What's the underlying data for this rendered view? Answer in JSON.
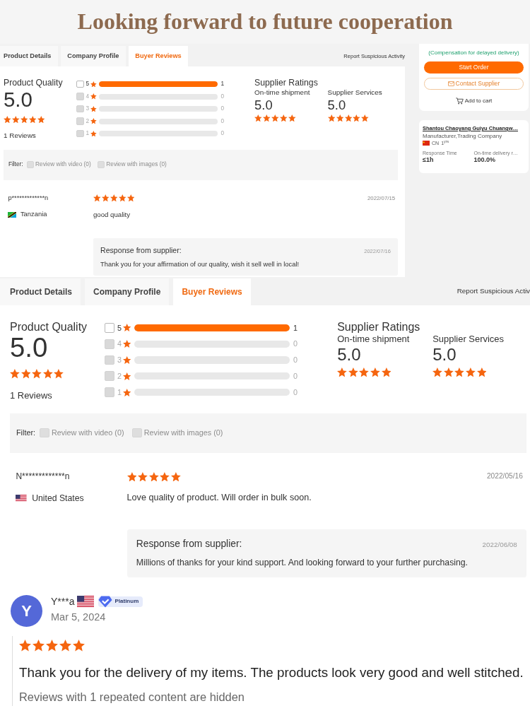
{
  "banner": {
    "title": "Looking forward to future cooperation"
  },
  "screens": [
    {
      "tabs": [
        {
          "label": "Product Details",
          "selected": false
        },
        {
          "label": "Company Profile",
          "selected": false
        },
        {
          "label": "Buyer Reviews",
          "selected": true
        }
      ],
      "report_link": "Report Suspicious Activity",
      "quality": {
        "label": "Product Quality",
        "score": "5.0",
        "stars": 5,
        "reviews": "1 Reviews"
      },
      "breakdown": [
        {
          "label": "5",
          "count": "1",
          "level": 1,
          "checked": false,
          "disabled": false
        },
        {
          "label": "4",
          "count": "0",
          "level": 0,
          "checked": false,
          "disabled": true
        },
        {
          "label": "3",
          "count": "0",
          "level": 0,
          "checked": false,
          "disabled": true
        },
        {
          "label": "2",
          "count": "0",
          "level": 0,
          "checked": false,
          "disabled": true
        },
        {
          "label": "1",
          "count": "0",
          "level": 0,
          "checked": false,
          "disabled": true
        }
      ],
      "supplier_ratings": {
        "title": "Supplier Ratings",
        "items": [
          {
            "label": "On-time shipment",
            "score": "5.0",
            "stars": 5
          },
          {
            "label": "Supplier Services",
            "score": "5.0",
            "stars": 5
          }
        ]
      },
      "filter": {
        "label": "Filter:",
        "options": [
          {
            "label": "Review with video (0)",
            "checked": false,
            "disabled": true
          },
          {
            "label": "Review with images (0)",
            "checked": false,
            "disabled": true
          }
        ]
      },
      "review": {
        "buyer": "p*************n",
        "country": "Tanzania",
        "stars": 5,
        "date": "2022/07/15",
        "text": "good quality",
        "response": {
          "title": "Response from supplier:",
          "date": "2022/07/16",
          "text": "Thank you for your affirmation of our quality, wish it sell well in local!"
        }
      }
    },
    {
      "tabs": [
        {
          "label": "Product Details",
          "selected": false
        },
        {
          "label": "Company Profile",
          "selected": false
        },
        {
          "label": "Buyer Reviews",
          "selected": true
        }
      ],
      "report_link": "Report Suspicious Activ",
      "quality": {
        "label": "Product Quality",
        "score": "5.0",
        "stars": 5,
        "reviews": "1 Reviews"
      },
      "breakdown": [
        {
          "label": "5",
          "count": "1",
          "level": 1,
          "checked": false,
          "disabled": false
        },
        {
          "label": "4",
          "count": "0",
          "level": 0,
          "checked": false,
          "disabled": true
        },
        {
          "label": "3",
          "count": "0",
          "level": 0,
          "checked": false,
          "disabled": true
        },
        {
          "label": "2",
          "count": "0",
          "level": 0,
          "checked": false,
          "disabled": true
        },
        {
          "label": "1",
          "count": "0",
          "level": 0,
          "checked": false,
          "disabled": true
        }
      ],
      "supplier_ratings": {
        "title": "Supplier Ratings",
        "items": [
          {
            "label": "On-time shipment",
            "score": "5.0",
            "stars": 5
          },
          {
            "label": "Supplier Services",
            "score": "5.0",
            "stars": 5
          }
        ]
      },
      "filter": {
        "label": "Filter:",
        "options": [
          {
            "label": "Review with video (0)",
            "checked": false,
            "disabled": true
          },
          {
            "label": "Review with images (0)",
            "checked": false,
            "disabled": true
          }
        ]
      },
      "review": {
        "buyer": "N*************n",
        "country": "United States",
        "stars": 5,
        "date": "2022/05/16",
        "text": "Love quality of product. Will order in bulk soon.",
        "response": {
          "title": "Response from supplier:",
          "date": "2022/06/08",
          "text": "Millions of thanks for your kind support. And looking forward to your further purchasing."
        }
      }
    }
  ],
  "sidebar": {
    "note": "(Compensation for delayed delivery)",
    "buttons": [
      {
        "kind": "primary",
        "label": "Start Order"
      },
      {
        "kind": "outline",
        "label": "Contact Supplier"
      },
      {
        "kind": "link",
        "label": "Add to cart"
      }
    ],
    "supplier": {
      "name": "Shantou Chaoyang Guiyu Chuangw…",
      "type": "Manufacturer,Trading Company",
      "country": "CN",
      "years": "1$^{yrs}$",
      "stats": [
        {
          "label": "Response Time",
          "value": "≤1h"
        },
        {
          "label": "On-time delivery r…",
          "value": "100.0%"
        }
      ]
    }
  },
  "customer_review": {
    "avatar": "Y",
    "name": "Y***a",
    "badge": "Platinum",
    "date": "Mar 5, 2024",
    "stars": 5,
    "text": "Thank you for the delivery of my items. The products look very good and well stitched.",
    "note": "Reviews with 1 repeated content are hidden"
  }
}
